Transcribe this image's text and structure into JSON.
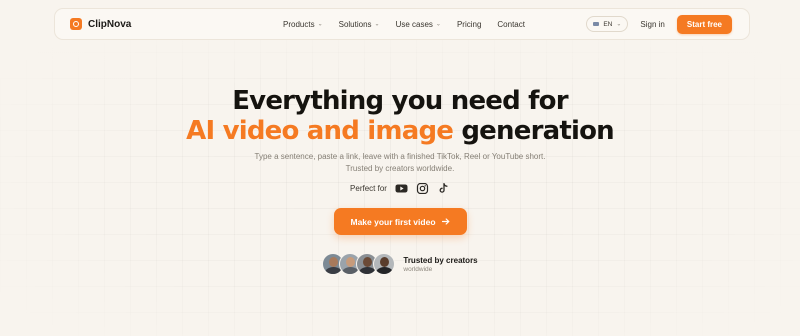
{
  "brand": {
    "name": "ClipNova",
    "accent": "#f57a22"
  },
  "nav": {
    "items": [
      {
        "label": "Products",
        "has_dropdown": true
      },
      {
        "label": "Solutions",
        "has_dropdown": true
      },
      {
        "label": "Use cases",
        "has_dropdown": true
      },
      {
        "label": "Pricing",
        "has_dropdown": false
      },
      {
        "label": "Contact",
        "has_dropdown": false
      }
    ],
    "language": "EN",
    "sign_in": "Sign in",
    "start_free": "Start free"
  },
  "hero": {
    "title_line1": "Everything you need for",
    "title_line2_accent": "AI video and image",
    "title_line2_rest": "generation",
    "subtitle": "Type a sentence, paste a link, leave with a finished TikTok, Reel or YouTube short. Trusted by creators worldwide.",
    "perfect_for": "Perfect for",
    "platform_icons": [
      "youtube-icon",
      "instagram-icon",
      "tiktok-icon"
    ],
    "cta": "Make your first video",
    "cta_icon": "arrow-right-icon"
  },
  "social_proof": {
    "title": "Trusted by creators",
    "subtitle": "worldwide",
    "avatar_count": 4
  }
}
